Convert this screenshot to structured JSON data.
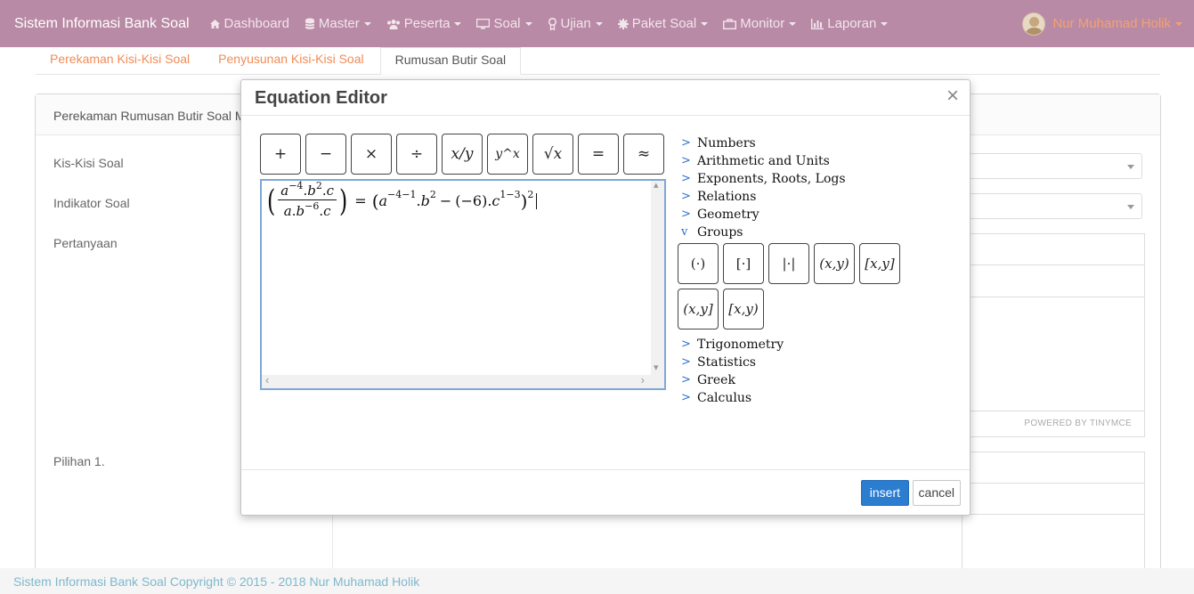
{
  "navbar": {
    "brand": "Sistem Informasi Bank Soal",
    "menu": [
      {
        "label": "Dashboard",
        "icon": "home-icon",
        "caret": false
      },
      {
        "label": "Master",
        "icon": "database-icon",
        "caret": true
      },
      {
        "label": "Peserta",
        "icon": "users-icon",
        "caret": true
      },
      {
        "label": "Soal",
        "icon": "monitor-icon",
        "caret": true
      },
      {
        "label": "Ujian",
        "icon": "award-icon",
        "caret": true
      },
      {
        "label": "Paket Soal",
        "icon": "gear-icon",
        "caret": true
      },
      {
        "label": "Monitor",
        "icon": "briefcase-icon",
        "caret": true
      },
      {
        "label": "Laporan",
        "icon": "bar-chart-icon",
        "caret": true
      }
    ],
    "user": "Nur Muhamad Holik"
  },
  "tabs": [
    "Perekaman Kisi-Kisi Soal",
    "Penyusunan Kisi-Kisi Soal",
    "Rumusan Butir Soal"
  ],
  "panel": {
    "title": "Perekaman Rumusan Butir Soal M",
    "labels": {
      "kisi": "Kis-Kisi Soal",
      "indikator": "Indikator Soal",
      "pertanyaan": "Pertanyaan",
      "pilihan": "Pilihan 1."
    },
    "powered": "POWERED BY TINYMCE"
  },
  "modal": {
    "title": "Equation Editor",
    "close": "×",
    "toolbar": [
      "+",
      "−",
      "×",
      "÷",
      "x/y",
      "y^x",
      "√x",
      "=",
      "≈"
    ],
    "equation": {
      "num": {
        "a_exp": "−4",
        "b_exp": "2"
      },
      "den": {
        "b_exp": "−6"
      },
      "rhs_a_exp": "−4−1",
      "rhs_b_exp": "2",
      "rhs_neg": "(−6)",
      "rhs_c_exp": "1−3",
      "outer_exp": "2"
    },
    "categories_top": [
      "Numbers",
      "Arithmetic and Units",
      "Exponents, Roots, Logs",
      "Relations",
      "Geometry"
    ],
    "expanded_category": "Groups",
    "group_buttons": [
      "(·)",
      "[·]",
      "|·|",
      "(x,y)",
      "[x,y]",
      "(x,y]",
      "[x,y)"
    ],
    "categories_bottom": [
      "Trigonometry",
      "Statistics",
      "Greek",
      "Calculus"
    ],
    "insert_label": "insert",
    "cancel_label": "cancel"
  },
  "footer": "Sistem Informasi Bank Soal Copyright © 2015 - 2018 Nur Muhamad Holik"
}
